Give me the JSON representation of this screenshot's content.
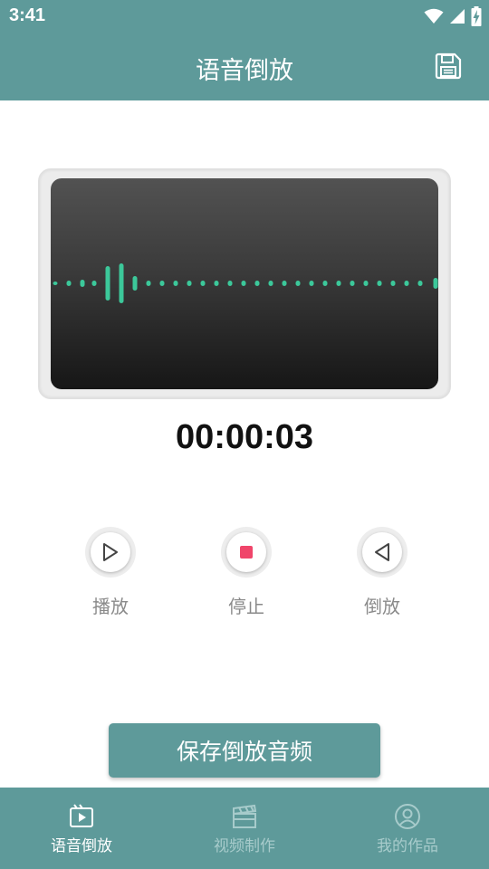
{
  "status_bar": {
    "time": "3:41"
  },
  "header": {
    "title": "语音倒放"
  },
  "player": {
    "elapsed": "00:00:03"
  },
  "controls": {
    "play_label": "播放",
    "stop_label": "停止",
    "reverse_label": "倒放"
  },
  "save_button_label": "保存倒放音频",
  "bottom_nav": {
    "items": [
      {
        "label": "语音倒放"
      },
      {
        "label": "视频制作"
      },
      {
        "label": "我的作品"
      }
    ]
  },
  "colors": {
    "primary": "#5e9a9a",
    "waveform": "#3cc89a",
    "stop_accent": "#f0456a",
    "nav_inactive": "#a7cbcb"
  },
  "icons": {
    "status": [
      "wifi-icon",
      "cellular-signal-icon",
      "battery-charging-icon"
    ],
    "header_action": "floppy-save-icon",
    "nav": [
      "video-play-icon",
      "clapperboard-icon",
      "user-circle-icon"
    ]
  }
}
